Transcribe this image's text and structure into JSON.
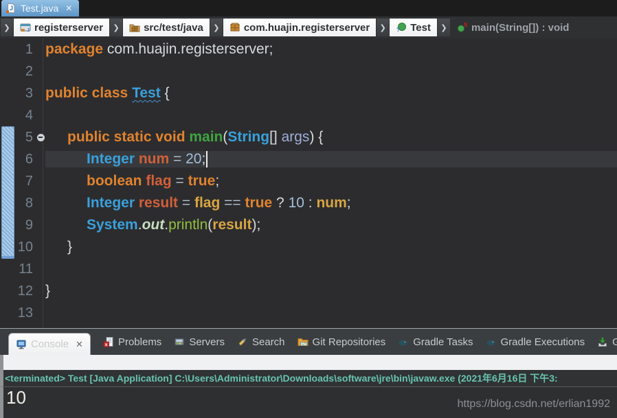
{
  "editor_tab": {
    "title": "Test.java",
    "close_icon": "✕"
  },
  "breadcrumb": {
    "chevron": "❯",
    "items": [
      {
        "label": "registerserver",
        "icon": "java-project-icon"
      },
      {
        "label": "src/test/java",
        "icon": "source-folder-icon"
      },
      {
        "label": "com.huajin.registerserver",
        "icon": "package-icon"
      },
      {
        "label": "Test",
        "icon": "class-icon"
      },
      {
        "label": "main(String[]) : void",
        "icon": "static-method-icon"
      }
    ]
  },
  "code": {
    "lines": [
      {
        "n": "1",
        "indent": 0,
        "tokens": [
          {
            "t": "package ",
            "c": "kw"
          },
          {
            "t": "com.huajin.registerserver;",
            "c": "pl"
          }
        ]
      },
      {
        "n": "2",
        "indent": 0,
        "tokens": []
      },
      {
        "n": "3",
        "indent": 0,
        "tokens": [
          {
            "t": "public class ",
            "c": "kw"
          },
          {
            "t": "Test",
            "c": "typeu"
          },
          {
            "t": " {",
            "c": "pl"
          }
        ]
      },
      {
        "n": "4",
        "indent": 0,
        "tokens": []
      },
      {
        "n": "5",
        "indent": 32,
        "fold": true,
        "tokens": [
          {
            "t": "public static void ",
            "c": "kw"
          },
          {
            "t": "main",
            "c": "mdecl"
          },
          {
            "t": "(",
            "c": "pl"
          },
          {
            "t": "String",
            "c": "type"
          },
          {
            "t": "[] ",
            "c": "pl"
          },
          {
            "t": "args",
            "c": "param"
          },
          {
            "t": ") {",
            "c": "pl"
          }
        ]
      },
      {
        "n": "6",
        "indent": 60,
        "current": true,
        "tokens": [
          {
            "t": "Integer",
            "c": "type"
          },
          {
            "t": " ",
            "c": "pl"
          },
          {
            "t": "num",
            "c": "vdecl"
          },
          {
            "t": " = ",
            "c": "op"
          },
          {
            "t": "20",
            "c": "num"
          },
          {
            "t": ";",
            "c": "pl"
          },
          {
            "t": "",
            "c": "caret"
          }
        ]
      },
      {
        "n": "7",
        "indent": 60,
        "tokens": [
          {
            "t": "boolean",
            "c": "kw"
          },
          {
            "t": " ",
            "c": "pl"
          },
          {
            "t": "flag",
            "c": "vdecl"
          },
          {
            "t": " = ",
            "c": "op"
          },
          {
            "t": "true",
            "c": "kw"
          },
          {
            "t": ";",
            "c": "pl"
          }
        ]
      },
      {
        "n": "8",
        "indent": 60,
        "tokens": [
          {
            "t": "Integer",
            "c": "type"
          },
          {
            "t": " ",
            "c": "pl"
          },
          {
            "t": "result",
            "c": "vdecl"
          },
          {
            "t": " = ",
            "c": "op"
          },
          {
            "t": "flag",
            "c": "vref"
          },
          {
            "t": " == ",
            "c": "op"
          },
          {
            "t": "true",
            "c": "kw"
          },
          {
            "t": " ? ",
            "c": "pl"
          },
          {
            "t": "10",
            "c": "num"
          },
          {
            "t": " : ",
            "c": "pl"
          },
          {
            "t": "num",
            "c": "vref"
          },
          {
            "t": ";",
            "c": "pl"
          }
        ]
      },
      {
        "n": "9",
        "indent": 60,
        "tokens": [
          {
            "t": "System",
            "c": "type"
          },
          {
            "t": ".",
            "c": "pl"
          },
          {
            "t": "out",
            "c": "field"
          },
          {
            "t": ".",
            "c": "pl"
          },
          {
            "t": "println",
            "c": "mcall"
          },
          {
            "t": "(",
            "c": "pl"
          },
          {
            "t": "result",
            "c": "vref"
          },
          {
            "t": ");",
            "c": "pl"
          }
        ]
      },
      {
        "n": "10",
        "indent": 32,
        "tokens": [
          {
            "t": "}",
            "c": "pl"
          }
        ]
      },
      {
        "n": "11",
        "indent": 0,
        "tokens": []
      },
      {
        "n": "12",
        "indent": 0,
        "tokens": [
          {
            "t": "}",
            "c": "pl"
          }
        ]
      },
      {
        "n": "13",
        "indent": 0,
        "tokens": []
      }
    ]
  },
  "bottom_tabs": {
    "items": [
      {
        "label": "Console",
        "close": "✕",
        "icon": "console-icon"
      },
      {
        "label": "Problems",
        "icon": "problems-icon"
      },
      {
        "label": "Servers",
        "icon": "servers-icon"
      },
      {
        "label": "Search",
        "icon": "search-icon"
      },
      {
        "label": "Git Repositories",
        "icon": "git-repositories-icon"
      },
      {
        "label": "Gradle Tasks",
        "icon": "gradle-icon"
      },
      {
        "label": "Gradle Executions",
        "icon": "gradle-icon"
      },
      {
        "label": "G",
        "icon": "import-icon"
      }
    ]
  },
  "console": {
    "terminated_text": "<terminated> Test [Java Application] C:\\Users\\Administrator\\Downloads\\software\\jre\\bin\\javaw.exe (2021年6月16日 下午3:",
    "output": "10"
  },
  "watermark": "https://blog.csdn.net/erlian1992",
  "palette": {
    "keyword": "#E0832F",
    "type_name": "#3AA0DC",
    "method_decl": "#3FA43F",
    "method_call": "#93BE3F",
    "static_field": "#C9DEC0",
    "var_decl": "#D2603A",
    "var_ref": "#D8A542",
    "number": "#A6BEDB",
    "operator": "#AEBBC7",
    "plain": "#D6DADD",
    "param": "#9FAEDB",
    "editor_bg": "#2C2C2E",
    "current_line": "#37393C",
    "line_number": "#76838F",
    "tab_grad_top": "#93C1E4",
    "tab_grad_bottom": "#5D95C6",
    "terminated_text_color": "#68C4B0",
    "watermark_color": "#8C9094"
  }
}
